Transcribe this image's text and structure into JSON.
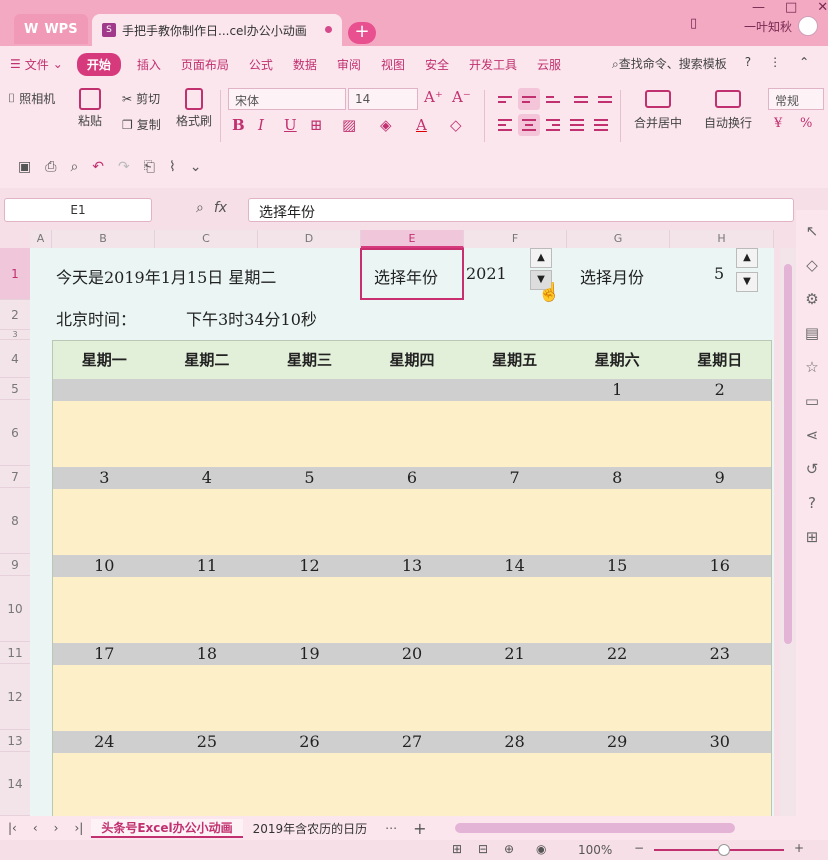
{
  "app": {
    "name": "WPS",
    "tab_title": "手把手教你制作日...cel办公小动画",
    "new_tab": "+"
  },
  "user": {
    "name": "一叶知秋"
  },
  "menu": {
    "file": "文件",
    "items": [
      "开始",
      "插入",
      "页面布局",
      "公式",
      "数据",
      "审阅",
      "视图",
      "安全",
      "开发工具",
      "云服"
    ],
    "search": "查找命令、搜索模板"
  },
  "ribbon": {
    "camera": "照相机",
    "paste": "粘贴",
    "cut": "剪切",
    "copy": "复制",
    "format_painter": "格式刷",
    "font_name": "宋体",
    "font_size": "14",
    "merge": "合并居中",
    "wrap": "自动换行",
    "number_format": "常规"
  },
  "formula_bar": {
    "cell_ref": "E1",
    "fx": "fx",
    "content": "选择年份"
  },
  "columns": [
    "A",
    "B",
    "C",
    "D",
    "E",
    "F",
    "G",
    "H"
  ],
  "rows": [
    "1",
    "2",
    "3",
    "4",
    "5",
    "6",
    "7",
    "8",
    "9",
    "10",
    "11",
    "12",
    "13",
    "14"
  ],
  "header": {
    "today": "今天是2019年1月15日  星期二",
    "select_year": "选择年份",
    "year": "2021",
    "select_month": "选择月份",
    "month": "5",
    "time_label": "北京时间：",
    "time_value": "下午3时34分10秒"
  },
  "calendar": {
    "weekdays": [
      "星期一",
      "星期二",
      "星期三",
      "星期四",
      "星期五",
      "星期六",
      "星期日"
    ],
    "weeks": [
      [
        "",
        "",
        "",
        "",
        "",
        "1",
        "2"
      ],
      [
        "3",
        "4",
        "5",
        "6",
        "7",
        "8",
        "9"
      ],
      [
        "10",
        "11",
        "12",
        "13",
        "14",
        "15",
        "16"
      ],
      [
        "17",
        "18",
        "19",
        "20",
        "21",
        "22",
        "23"
      ],
      [
        "24",
        "25",
        "26",
        "27",
        "28",
        "29",
        "30"
      ]
    ]
  },
  "sheet_tabs": [
    "头条号Excel办公小动画",
    "2019年含农历的日历"
  ],
  "status": {
    "zoom": "100%"
  },
  "colors": {
    "accent": "#d63a7d",
    "calendar_header": "#e2efd9",
    "date_row": "#cfcfcf",
    "day_body": "#fdf0c8"
  }
}
